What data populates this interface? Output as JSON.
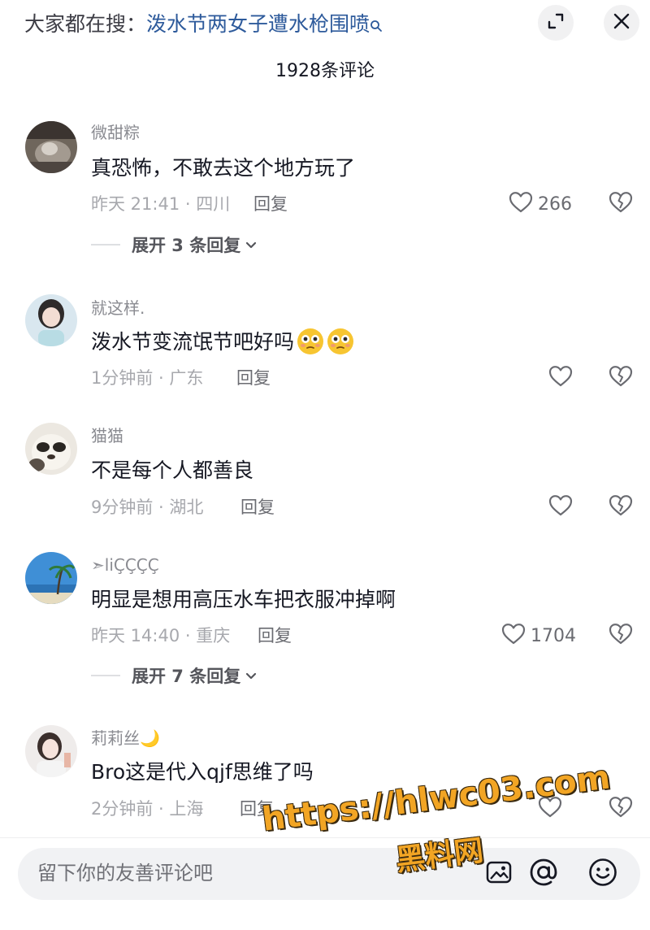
{
  "header": {
    "search_prefix": "大家都在搜：",
    "search_query": "泼水节两女子遭水枪围喷"
  },
  "comment_count": "1928条评论",
  "comments": [
    {
      "username": "微甜粽",
      "content": "真恐怖，不敢去这个地方玩了",
      "meta": "昨天 21:41 · 四川",
      "reply_label": "回复",
      "likes": "266",
      "expand_label": "展开 3 条回复"
    },
    {
      "username": "就这样.",
      "content": "泼水节变流氓节吧好吗",
      "meta": "1分钟前 · 广东",
      "reply_label": "回复",
      "likes": "",
      "expand_label": ""
    },
    {
      "username": "猫猫",
      "content": "不是每个人都善良",
      "meta": "9分钟前 · 湖北",
      "reply_label": "回复",
      "likes": "",
      "expand_label": ""
    },
    {
      "username": "➣liÇÇÇÇ",
      "content": "明显是想用高压水车把衣服冲掉啊",
      "meta": "昨天 14:40 · 重庆",
      "reply_label": "回复",
      "likes": "1704",
      "expand_label": "展开 7 条回复"
    },
    {
      "username": "莉莉丝🌙",
      "content": "Bro这是代入qjf思维了吗",
      "meta": "2分钟前 · 上海",
      "reply_label": "回复",
      "likes": "",
      "expand_label": ""
    }
  ],
  "input": {
    "placeholder": "留下你的友善评论吧"
  },
  "watermark": {
    "url": "https://hlwc03.com",
    "name": "黑料网"
  },
  "icons": {
    "search": "search-icon",
    "expand": "expand-icon",
    "close": "close-icon",
    "like": "heart-icon",
    "dislike": "broken-heart-icon",
    "image": "image-icon",
    "mention": "at-icon",
    "emoji": "emoji-icon"
  },
  "colors": {
    "query_link": "#2d5a9b",
    "secondary_text": "#a7a8ad",
    "watermark": "#f2a524"
  }
}
